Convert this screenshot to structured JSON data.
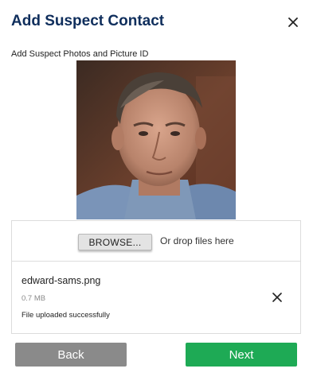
{
  "dialog": {
    "title": "Add Suspect Contact",
    "close_icon": "close-icon",
    "subtitle": "Add Suspect Photos and Picture ID"
  },
  "photo": {
    "description_icon": "suspect-photo"
  },
  "upload": {
    "browse_label": "BROWSE...",
    "drop_text": "Or drop files here"
  },
  "file": {
    "name": "edward-sams.png",
    "size": "0.7 MB",
    "status": "File uploaded successfully",
    "remove_icon": "close-icon"
  },
  "actions": {
    "back_label": "Back",
    "next_label": "Next"
  },
  "colors": {
    "title": "#0f2e5c",
    "next_button": "#1eaa55",
    "back_button": "#8a8a8a"
  }
}
